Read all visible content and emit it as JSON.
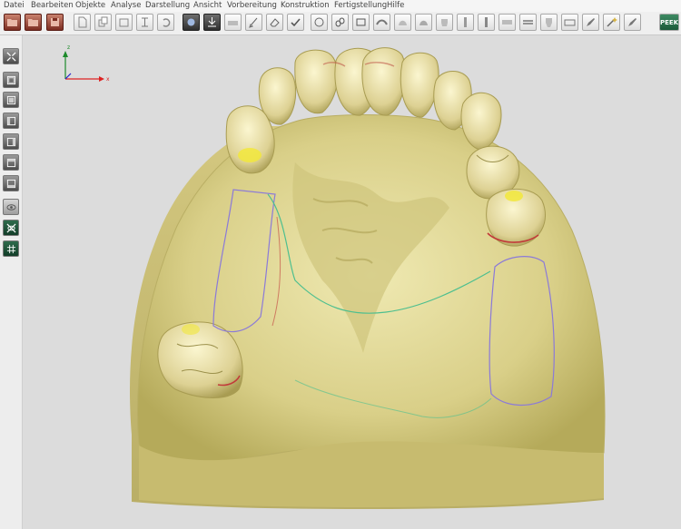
{
  "menu": [
    "Datei",
    "Bearbeiten",
    "Objekte",
    "Analyse",
    "Darstellung",
    "Ansicht",
    "Vorbereitung",
    "Konstruktion",
    "Fertigstellung",
    "Hilfe"
  ],
  "toolbar": {
    "peek_label": "PEEK",
    "icons": [
      "open-folder-icon",
      "open-folder-icon",
      "save-icon",
      "new-file-icon",
      "copy-icon",
      "measure-icon",
      "undo-icon",
      "select-hand-icon",
      "import-icon",
      "scan-icon",
      "brush-icon",
      "eraser-icon",
      "checkmark-icon",
      "model-icon",
      "link-icon",
      "crown-icon",
      "arch-icon",
      "arch-icon",
      "arch-icon",
      "tooth-icon",
      "tooth-icon",
      "tooth-icon",
      "connector-icon",
      "bar-icon",
      "tooth-icon",
      "bridge-icon",
      "edit-icon",
      "wand-icon",
      "peek-icon"
    ]
  },
  "sidebar": {
    "icons": [
      "fit-view-icon",
      "view-front-icon",
      "view-back-icon",
      "view-left-icon",
      "view-right-icon",
      "view-top-icon",
      "view-bottom-icon",
      "visibility-icon",
      "hide-objects-icon",
      "grid-icon"
    ]
  },
  "viewport": {
    "axis_z_label": "z",
    "axis_x_label": "x",
    "colors": {
      "background": "#dcdcdc",
      "model": "#d8d08a",
      "margin_line_red": "#c23a3a",
      "outline_purple": "#8b7ad8",
      "outline_green": "#4dbf8f",
      "prep_yellow": "#f2e83b"
    }
  }
}
